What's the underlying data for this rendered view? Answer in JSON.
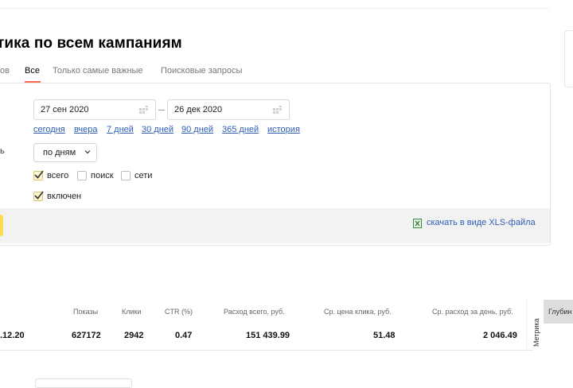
{
  "page": {
    "title": "тика по всем кампаниям"
  },
  "tabs": [
    {
      "label": "ов",
      "active": false
    },
    {
      "label": "Все",
      "active": true
    },
    {
      "label": "Только самые важные",
      "active": false
    },
    {
      "label": "Поисковые запросы",
      "active": false
    }
  ],
  "filters": {
    "date_from": "27 сен 2020",
    "date_to": "26 дек 2020",
    "quick_ranges": [
      "сегодня",
      "вчера",
      "7 дней",
      "30 дней",
      "90 дней",
      "365 дней",
      "история"
    ],
    "group_label_cut": "ь",
    "grouping": "по дням",
    "sources": [
      {
        "label": "всего",
        "checked": true
      },
      {
        "label": "поиск",
        "checked": false
      },
      {
        "label": "сети",
        "checked": false
      }
    ],
    "status": {
      "label": "включен",
      "checked": true
    },
    "download_label": "скачать в виде XLS-файла"
  },
  "table": {
    "headers": [
      "Показы",
      "Клики",
      "CTR (%)",
      "Расход всего, руб.",
      "Ср. цена клика, руб.",
      "Ср. расход за день, руб."
    ],
    "row": {
      "date": ".12.20",
      "values": [
        "627172",
        "2942",
        "0.47",
        "151 439.99",
        "51.48",
        "2 046.49"
      ]
    },
    "metrika_label": "Метрика",
    "extra_header": "Глубин"
  },
  "colors": {
    "link": "#2e5db5",
    "accent_underline": "#ff6a4d",
    "primary_button": "#ffdb4d"
  }
}
